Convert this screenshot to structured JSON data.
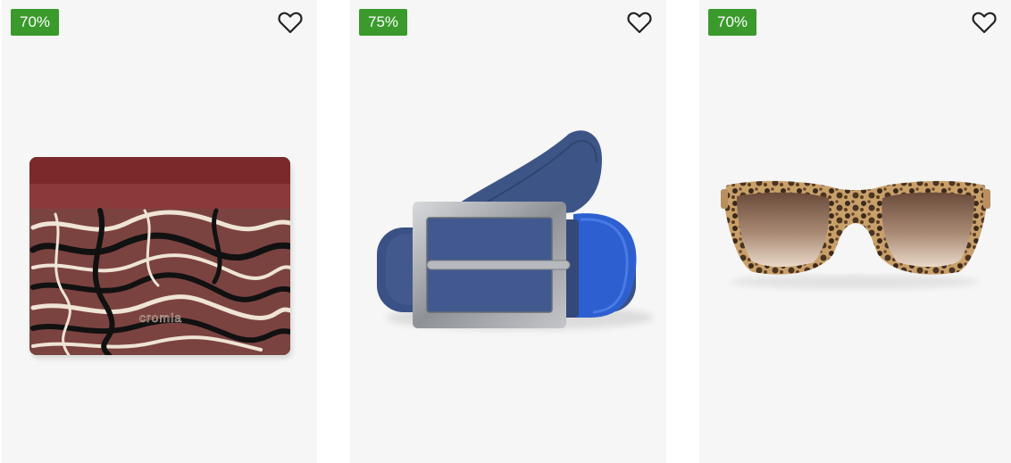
{
  "products": [
    {
      "discount": "70%",
      "wishlist_icon": "heart-outline-icon",
      "image": "card-holder"
    },
    {
      "discount": "75%",
      "wishlist_icon": "heart-outline-icon",
      "image": "belt"
    },
    {
      "discount": "70%",
      "wishlist_icon": "heart-outline-icon",
      "image": "sunglasses"
    }
  ],
  "colors": {
    "badge": "#3a9a2c",
    "card_background": "#f6f6f6"
  }
}
